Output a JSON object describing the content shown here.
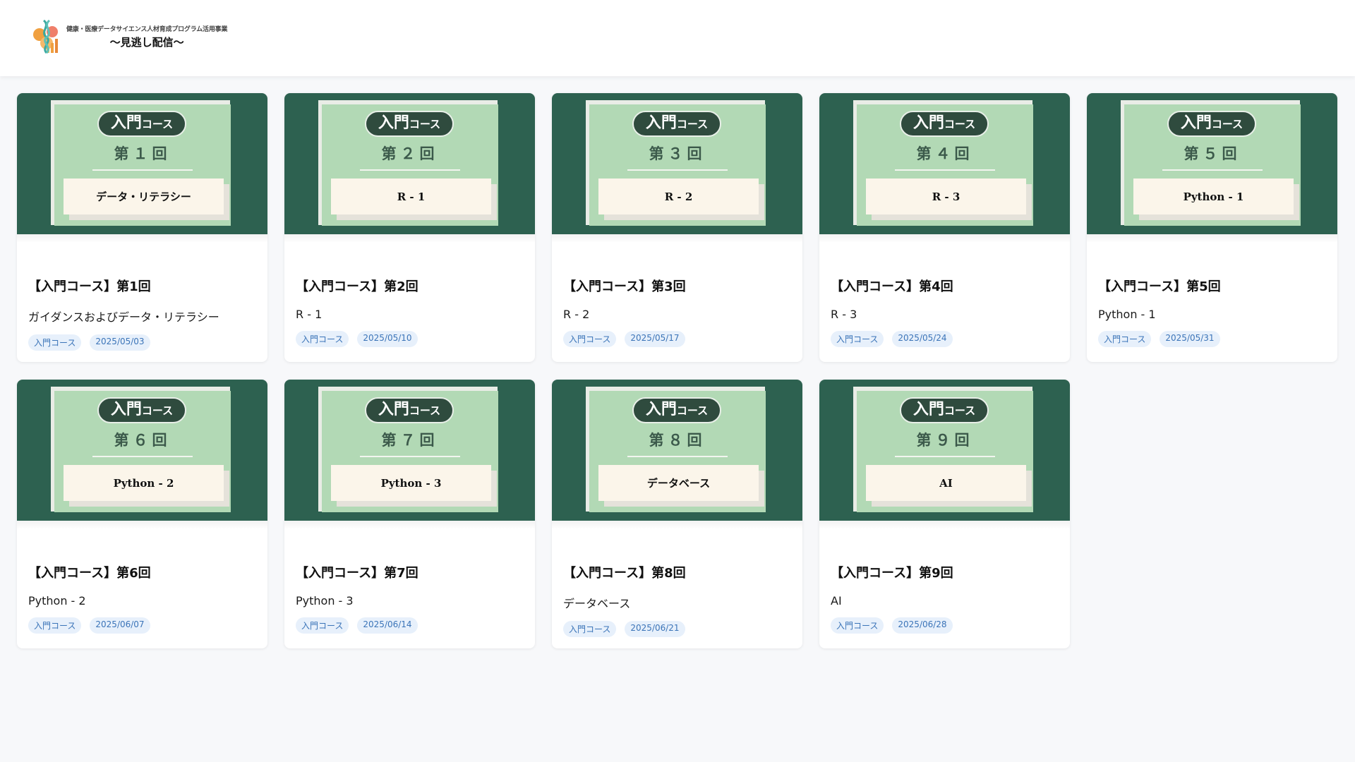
{
  "header": {
    "logo_subtitle": "健康・医療データサイエンス人材育成プログラム活用事業",
    "logo_title": "〜見逃し配信〜"
  },
  "thumbnail": {
    "badge_big": "入門",
    "badge_small": "コース"
  },
  "colors": {
    "thumbnail_bg": "#2d6150",
    "paper": "#b2d9b5",
    "badge": "#2f4b3e",
    "tag_bg": "#e7f0fb",
    "tag_text": "#3b74b8"
  },
  "cards": [
    {
      "thumb_number": "第１回",
      "thumb_topic": "データ・リテラシー",
      "title": "【入門コース】第1回",
      "subtitle": "ガイダンスおよびデータ・リテラシー",
      "tag": "入門コース",
      "date": "2025/05/03"
    },
    {
      "thumb_number": "第２回",
      "thumb_topic": "R - 1",
      "title": "【入門コース】第2回",
      "subtitle": "R - 1",
      "tag": "入門コース",
      "date": "2025/05/10"
    },
    {
      "thumb_number": "第３回",
      "thumb_topic": "R - 2",
      "title": "【入門コース】第3回",
      "subtitle": "R - 2",
      "tag": "入門コース",
      "date": "2025/05/17"
    },
    {
      "thumb_number": "第４回",
      "thumb_topic": "R - 3",
      "title": "【入門コース】第4回",
      "subtitle": "R - 3",
      "tag": "入門コース",
      "date": "2025/05/24"
    },
    {
      "thumb_number": "第５回",
      "thumb_topic": "Python - 1",
      "title": "【入門コース】第5回",
      "subtitle": "Python - 1",
      "tag": "入門コース",
      "date": "2025/05/31"
    },
    {
      "thumb_number": "第６回",
      "thumb_topic": "Python - 2",
      "title": "【入門コース】第6回",
      "subtitle": "Python - 2",
      "tag": "入門コース",
      "date": "2025/06/07"
    },
    {
      "thumb_number": "第７回",
      "thumb_topic": "Python - 3",
      "title": "【入門コース】第7回",
      "subtitle": "Python - 3",
      "tag": "入門コース",
      "date": "2025/06/14"
    },
    {
      "thumb_number": "第８回",
      "thumb_topic": "データベース",
      "title": "【入門コース】第8回",
      "subtitle": "データベース",
      "tag": "入門コース",
      "date": "2025/06/21"
    },
    {
      "thumb_number": "第９回",
      "thumb_topic": "AI",
      "title": "【入門コース】第9回",
      "subtitle": "AI",
      "tag": "入門コース",
      "date": "2025/06/28"
    }
  ]
}
